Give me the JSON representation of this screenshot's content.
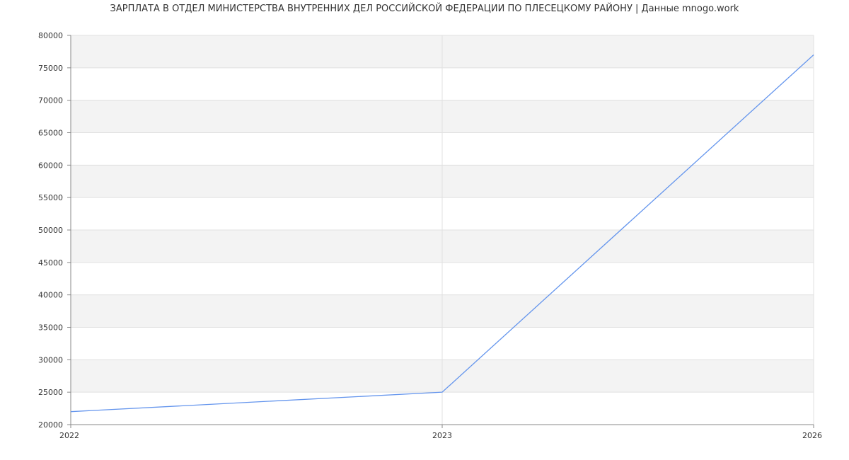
{
  "chart_data": {
    "type": "line",
    "title": "ЗАРПЛАТА В ОТДЕЛ МИНИСТЕРСТВА ВНУТРЕННИХ ДЕЛ РОССИЙСКОЙ ФЕДЕРАЦИИ ПО ПЛЕСЕЦКОМУ РАЙОНУ | Данные mnogo.work",
    "x": [
      "2022",
      "2023",
      "2026"
    ],
    "series": [
      {
        "values": [
          22000,
          25000,
          77000
        ]
      }
    ],
    "ylim": [
      20000,
      80000
    ],
    "yticks": [
      20000,
      25000,
      30000,
      35000,
      40000,
      45000,
      50000,
      55000,
      60000,
      65000,
      70000,
      75000,
      80000
    ],
    "grid": true,
    "colors": {
      "line": "#6495ed",
      "band": "#f3f3f3",
      "grid": "#e0e0e0",
      "axis": "#888888"
    }
  }
}
